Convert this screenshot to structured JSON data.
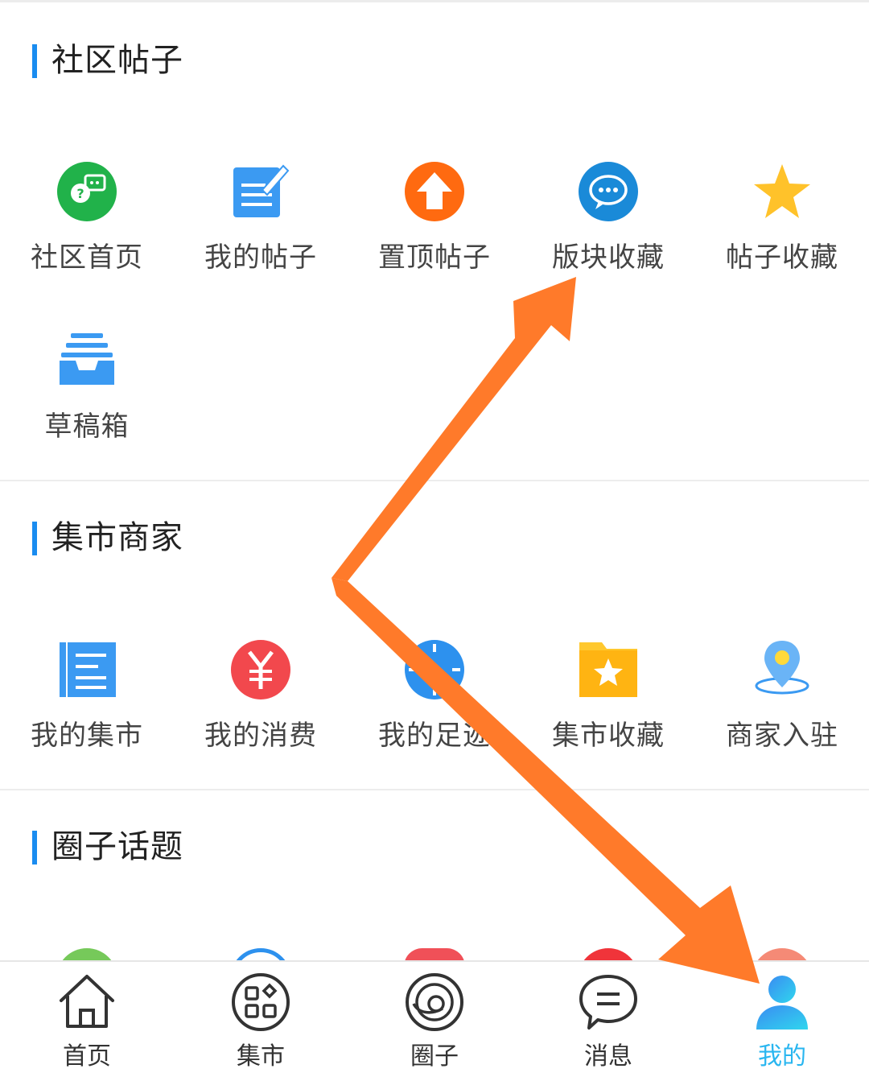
{
  "sections": [
    {
      "title": "社区帖子",
      "items": [
        {
          "label": "社区首页",
          "icon": "community-chat-icon"
        },
        {
          "label": "我的帖子",
          "icon": "edit-note-icon"
        },
        {
          "label": "置顶帖子",
          "icon": "pin-top-icon"
        },
        {
          "label": "版块收藏",
          "icon": "forum-chat-icon"
        },
        {
          "label": "帖子收藏",
          "icon": "star-icon"
        },
        {
          "label": "草稿箱",
          "icon": "drafts-tray-icon"
        }
      ]
    },
    {
      "title": "集市商家",
      "items": [
        {
          "label": "我的集市",
          "icon": "list-doc-icon"
        },
        {
          "label": "我的消费",
          "icon": "yuan-icon"
        },
        {
          "label": "我的足迹",
          "icon": "compass-icon"
        },
        {
          "label": "集市收藏",
          "icon": "star-folder-icon"
        },
        {
          "label": "商家入驻",
          "icon": "location-pin-icon"
        }
      ]
    },
    {
      "title": "圈子话题"
    }
  ],
  "tabbar": [
    {
      "label": "首页",
      "icon": "home-icon"
    },
    {
      "label": "集市",
      "icon": "grid-apps-icon"
    },
    {
      "label": "圈子",
      "icon": "orbit-icon"
    },
    {
      "label": "消息",
      "icon": "message-bubble-icon"
    },
    {
      "label": "我的",
      "icon": "user-icon",
      "active": true
    }
  ],
  "colors": {
    "accent": "#1a8cf0",
    "tab_active": "#29b6f0",
    "annotation_arrow": "#ff7a2a"
  }
}
